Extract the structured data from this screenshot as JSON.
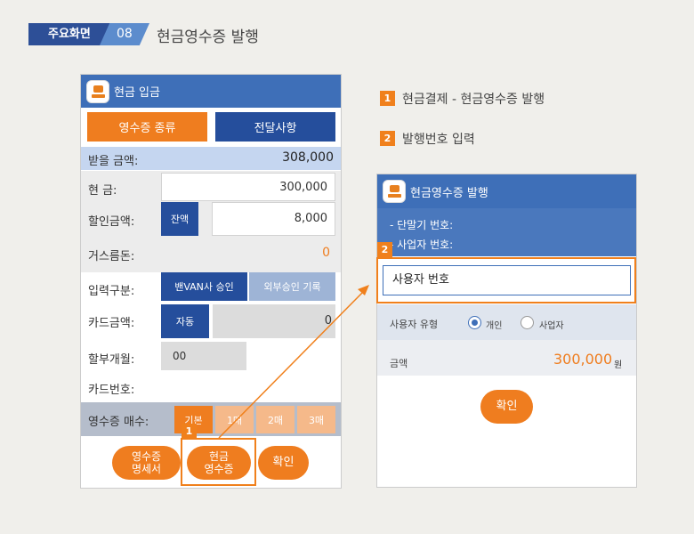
{
  "header": {
    "tag_main": "주요화면",
    "tag_num": "08",
    "title": "현금영수증 발행"
  },
  "phone1": {
    "appbar_title": "현금 입금",
    "tab_receipt_type": "영수증 종류",
    "tab_message": "전달사항",
    "amount_due_label": "받을 금액:",
    "amount_due_value": "308,000",
    "cash_label": "현 금:",
    "cash_value": "300,000",
    "discount_label": "할인금액:",
    "discount_button": "잔액",
    "discount_value": "8,000",
    "change_label": "거스름돈:",
    "change_value": "0",
    "input_type_label": "입력구분:",
    "input_type_van": "밴VAN사 승인",
    "input_type_external": "외부승인 기록",
    "card_amount_label": "카드금액:",
    "card_auto_button": "자동",
    "card_amount_value": "0",
    "installment_label": "할부개월:",
    "installment_value": "00",
    "card_number_label": "카드번호:",
    "receipt_count_label": "영수증 매수:",
    "receipt_counts": [
      "기본",
      "1매",
      "2매",
      "3매"
    ],
    "btn_receipt_line1": "영수증",
    "btn_receipt_line2": "명세서",
    "btn_cash_line1": "현금",
    "btn_cash_line2": "영수증",
    "btn_confirm": "확인"
  },
  "callouts": [
    {
      "num": "1",
      "text": "현금결제 - 현금영수증 발행"
    },
    {
      "num": "2",
      "text": "발행번호 입력"
    }
  ],
  "phone2": {
    "appbar_title": "현금영수증 발행",
    "terminal_label": "- 단말기 번호:",
    "business_label": "- 사업자 번호:",
    "user_number_placeholder": "사용자 번호",
    "user_type_label": "사용자 유형",
    "user_type_personal": "개인",
    "user_type_business": "사업자",
    "amount_label": "금액",
    "amount_value": "300,000",
    "amount_unit": "원",
    "btn_confirm": "확인"
  },
  "colors": {
    "accent": "#ef7d1f",
    "navy": "#254e9c",
    "appbar": "#3e6fb8"
  }
}
